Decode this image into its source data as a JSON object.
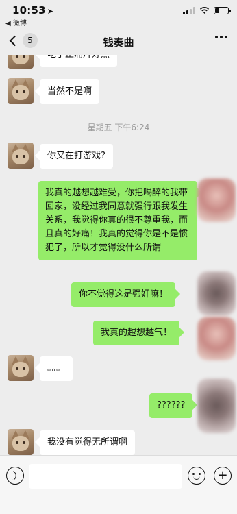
{
  "status": {
    "time": "10:53",
    "location_arrow": "➤",
    "back_app": "◀ 微博"
  },
  "header": {
    "back_badge": "5",
    "title": "钱奏曲"
  },
  "messages": {
    "partial_top": "吃了止痛片好点",
    "m1": "当然不是啊",
    "timestamp": "星期五 下午6:24",
    "m2": "你又在打游戏?",
    "m3": "我真的越想越难受，你把喝醉的我带回家，没经过我同意就强行跟我发生关系，我觉得你真的很不尊重我，而且真的好痛！我真的觉得你是不是惯犯了，所以才觉得没什么所谓",
    "m4": "你不觉得这是强奸嘛！",
    "m5": "我真的越想越气！",
    "m6": "。。。",
    "m7": "??????",
    "m8": "我没有觉得无所谓啊"
  },
  "icons": {
    "voice": "voice-icon",
    "emoji": "emoji-icon",
    "plus": "plus-icon",
    "back": "chevron-left-icon",
    "more": "more-icon",
    "wifi": "wifi-icon",
    "battery": "battery-icon",
    "signal": "signal-icon"
  },
  "colors": {
    "outgoing_bubble": "#95ec69",
    "incoming_bubble": "#ffffff",
    "background": "#ededed"
  }
}
